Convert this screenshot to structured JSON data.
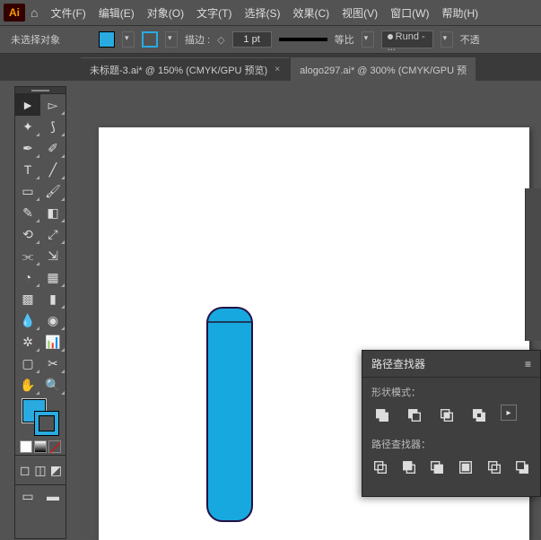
{
  "app": {
    "logo": "Ai"
  },
  "menu": {
    "file": "文件(F)",
    "edit": "编辑(E)",
    "object": "对象(O)",
    "type": "文字(T)",
    "select": "选择(S)",
    "effect": "效果(C)",
    "view": "视图(V)",
    "window": "窗口(W)",
    "help": "帮助(H)"
  },
  "optbar": {
    "no_selection": "未选择对象",
    "stroke_label": "描边 :",
    "stroke_weight": "1 pt",
    "uniform": "等比",
    "cap": "Rund - ...",
    "opacity": "不透"
  },
  "tabs": [
    {
      "label": "未标题-3.ai* @ 150% (CMYK/GPU 预览)",
      "active": false
    },
    {
      "label": "alogo297.ai* @ 300% (CMYK/GPU 预",
      "active": true
    }
  ],
  "panel": {
    "title": "路径查找器",
    "shape_modes": "形状模式：",
    "pathfinders": "路径查找器："
  },
  "colors": {
    "fill": "#29abe2",
    "stroke": "#29abe2"
  }
}
